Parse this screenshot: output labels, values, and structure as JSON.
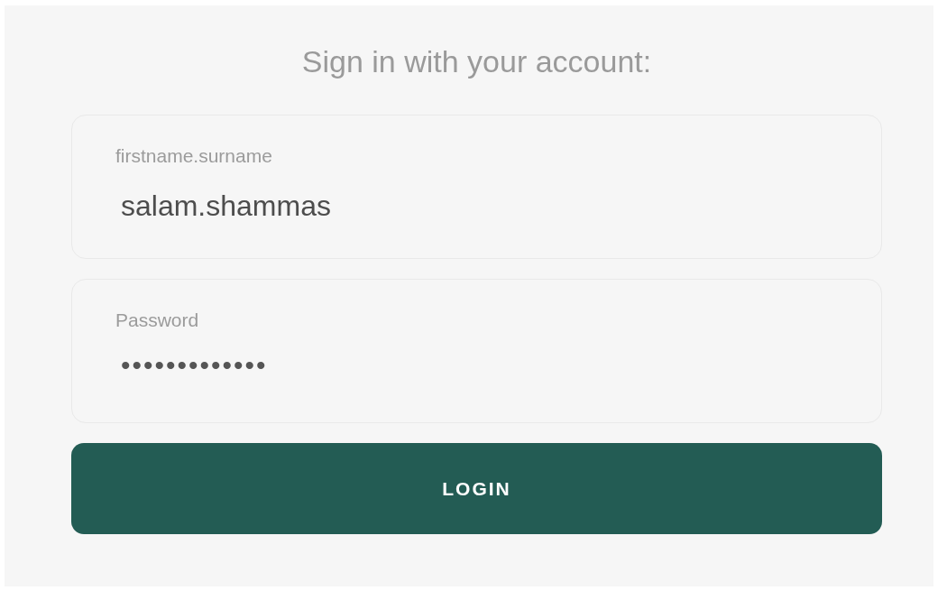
{
  "title": "Sign in with your account:",
  "fields": [
    {
      "kind": "text",
      "label": "firstname.surname",
      "value": "salam.shammas"
    },
    {
      "kind": "password",
      "label": "Password",
      "value": "•••••••••••••"
    }
  ],
  "button": "LOGIN"
}
